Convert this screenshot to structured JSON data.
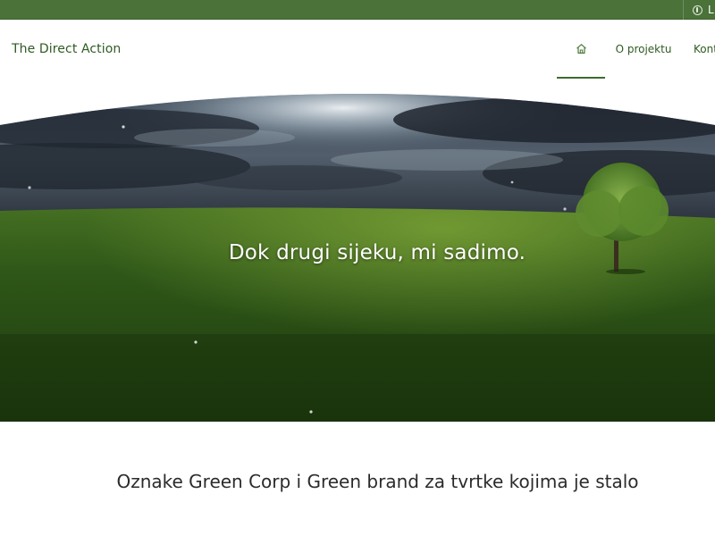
{
  "topbar": {
    "login_label": "L",
    "icon": "user-icon"
  },
  "header": {
    "brand": "The Direct Action",
    "nav": [
      {
        "label": "",
        "icon": "home-icon",
        "active": true
      },
      {
        "label": "O projektu"
      },
      {
        "label": "Kont"
      }
    ]
  },
  "hero": {
    "headline": "Dok drugi sijeku, mi sadimo."
  },
  "section": {
    "heading": "Oznake Green Corp i Green brand za tvrtke kojima je stalo"
  },
  "colors": {
    "topbar": "#4a7239",
    "accent": "#3e6b2e",
    "brand_text": "#2f5a22"
  }
}
